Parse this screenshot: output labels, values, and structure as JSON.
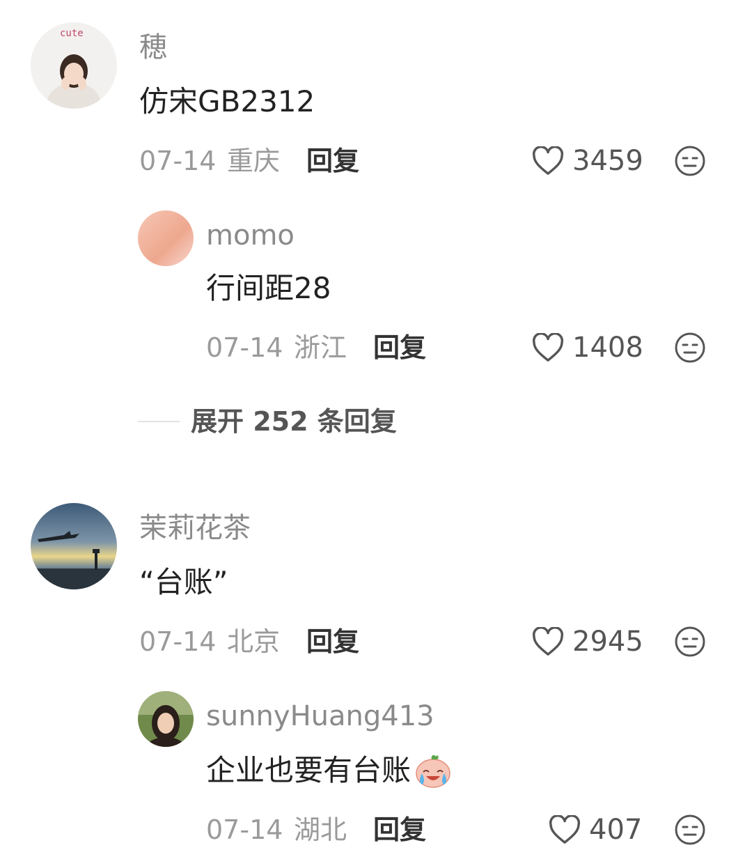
{
  "comments": [
    {
      "name": "穂",
      "avatar_text": "cute",
      "content": "仿宋GB2312",
      "date": "07-14",
      "location": "重庆",
      "reply_label": "回复",
      "likes": "3459",
      "replies": [
        {
          "name": "momo",
          "content": "行间距28",
          "date": "07-14",
          "location": "浙江",
          "reply_label": "回复",
          "likes": "1408"
        }
      ],
      "expand_label": "展开 252 条回复"
    },
    {
      "name": "茉莉花茶",
      "content": "“台账”",
      "date": "07-14",
      "location": "北京",
      "reply_label": "回复",
      "likes": "2945",
      "replies": [
        {
          "name": "sunnyHuang413",
          "content": "企业也要有台账",
          "emoji": "crying-emoji",
          "date": "07-14",
          "location": "湖北",
          "reply_label": "回复",
          "likes": "407"
        }
      ]
    }
  ],
  "colors": {
    "name": "#8a8a8a",
    "content": "#222222",
    "meta": "#9a9a9a",
    "icon": "#555555"
  },
  "icons": {
    "like": "heart-outline-icon",
    "dislike": "meh-face-icon"
  }
}
